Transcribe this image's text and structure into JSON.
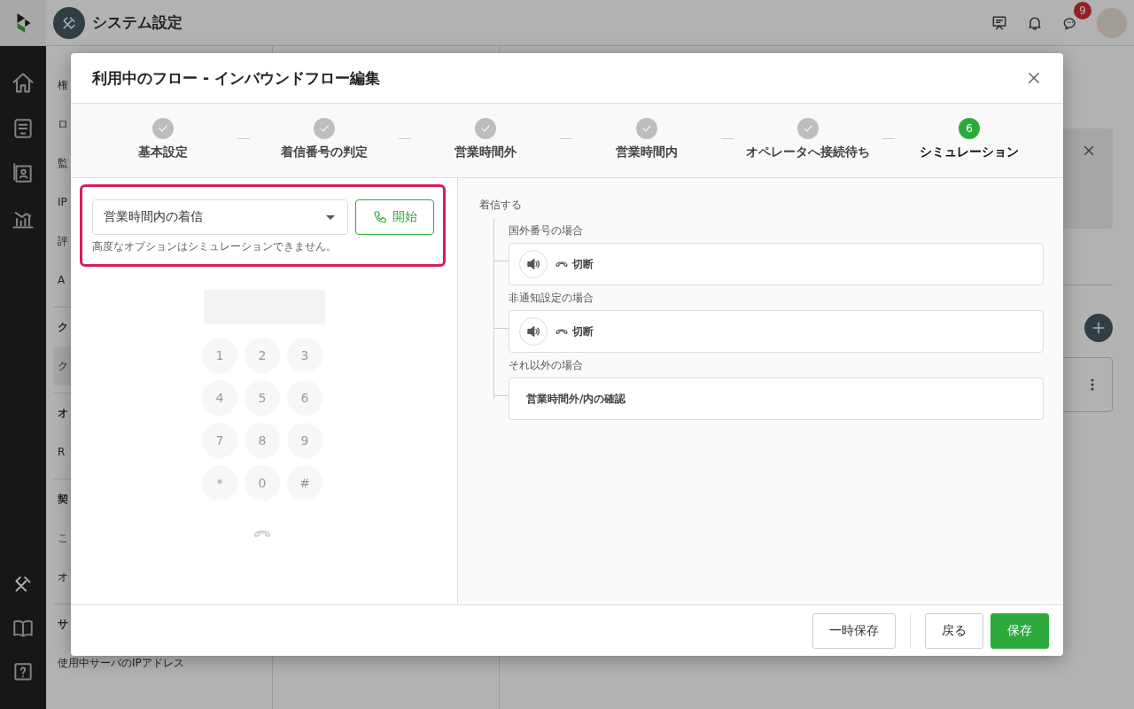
{
  "app": {
    "title": "システム設定",
    "chat_badge": "9"
  },
  "sidebar": [
    {
      "kind": "item",
      "text": "権",
      "selected": false
    },
    {
      "kind": "item",
      "text": "ロ",
      "selected": false
    },
    {
      "kind": "item",
      "text": "監",
      "selected": false
    },
    {
      "kind": "item",
      "text": "IP",
      "selected": false
    },
    {
      "kind": "item",
      "text": "評",
      "selected": false
    },
    {
      "kind": "item",
      "text": "A",
      "selected": false
    },
    {
      "kind": "section",
      "text": "ク"
    },
    {
      "kind": "item",
      "text": "ク",
      "selected": true
    },
    {
      "kind": "section",
      "text": "オ"
    },
    {
      "kind": "item",
      "text": "R",
      "selected": false
    },
    {
      "kind": "section",
      "text": "契"
    },
    {
      "kind": "item",
      "text": "こ",
      "selected": false
    },
    {
      "kind": "item",
      "text": "オ",
      "selected": false
    },
    {
      "kind": "section",
      "text": "サ"
    },
    {
      "kind": "item",
      "text": "使用中サーバのIPアドレス",
      "selected": false
    }
  ],
  "modal": {
    "title": "利用中のフロー - インバウンドフロー編集",
    "steps": [
      {
        "label": "基本設定",
        "done": true,
        "selected": false
      },
      {
        "label": "着信番号の判定",
        "done": true,
        "selected": false
      },
      {
        "label": "営業時間外",
        "done": true,
        "selected": false
      },
      {
        "label": "営業時間内",
        "done": true,
        "selected": false
      },
      {
        "label": "オペレータへ接続待ち",
        "done": true,
        "selected": false
      },
      {
        "label": "シミュレーション",
        "done": false,
        "selected": true,
        "number": "6"
      }
    ],
    "simulation": {
      "call_type": "営業時間内の着信",
      "start_button": "開始",
      "note": "高度なオプションはシミュレーションできません。",
      "dialpad": {
        "disabled": true,
        "keys": [
          "1",
          "2",
          "3",
          "4",
          "5",
          "6",
          "7",
          "8",
          "9",
          "*",
          "0",
          "#"
        ]
      }
    },
    "flow": {
      "root": "着信する",
      "branches": [
        {
          "condition": "国外番号の場合",
          "node": {
            "kind": "hangup",
            "label": "切断"
          }
        },
        {
          "condition": "非通知設定の場合",
          "node": {
            "kind": "hangup",
            "label": "切断"
          }
        },
        {
          "condition": "それ以外の場合",
          "node": {
            "kind": "step",
            "label": "営業時間外/内の確認"
          }
        }
      ]
    },
    "footer_buttons": [
      {
        "label": "一時保存",
        "kind": "secondary"
      },
      {
        "label": "戻る",
        "kind": "secondary"
      },
      {
        "label": "保存",
        "kind": "primary"
      }
    ]
  }
}
